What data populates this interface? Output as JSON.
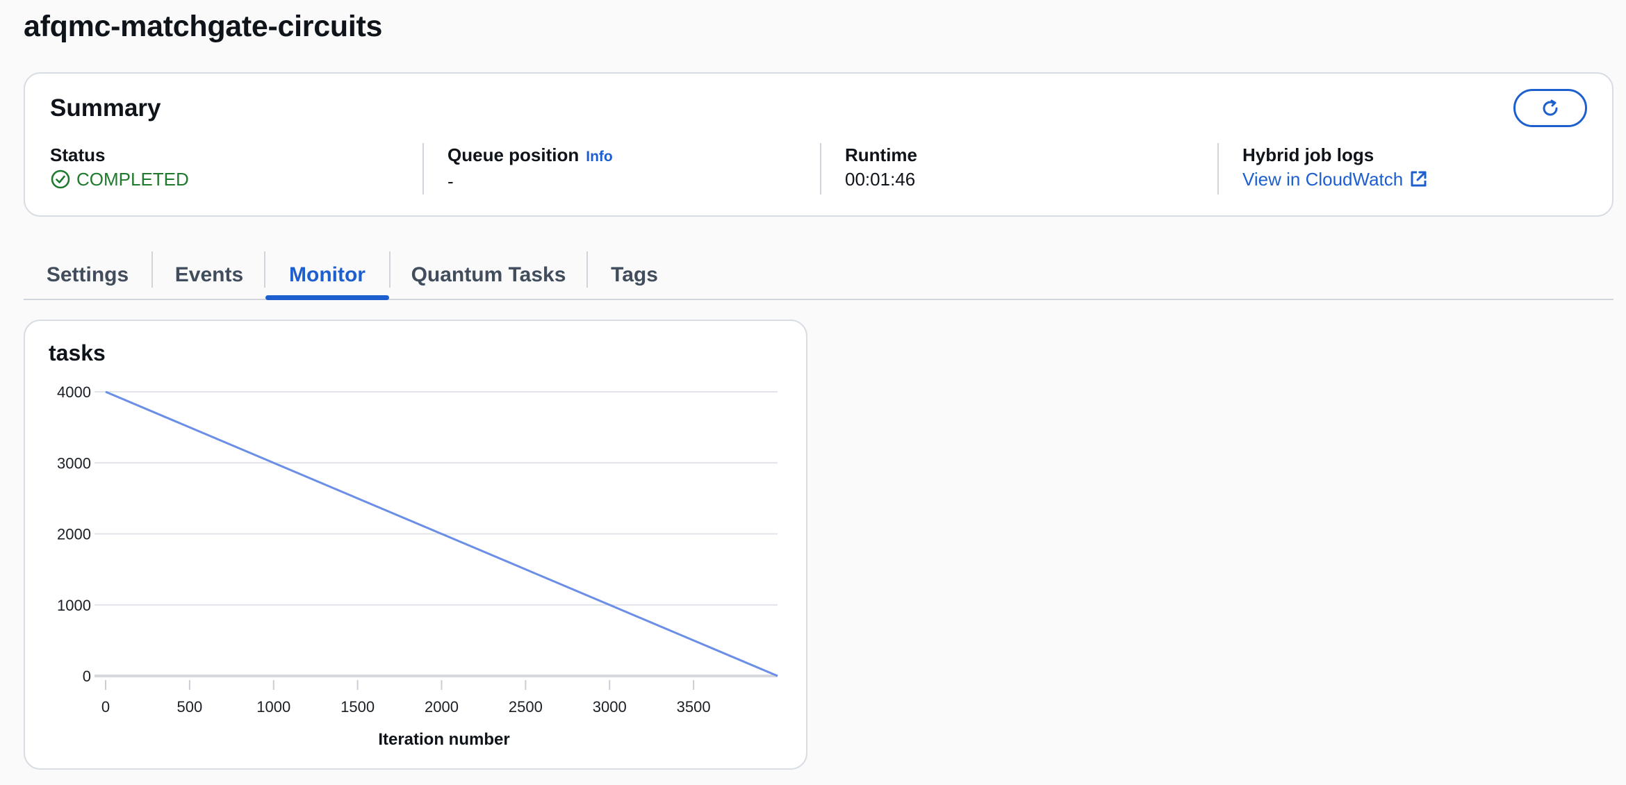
{
  "page": {
    "title": "afqmc-matchgate-circuits"
  },
  "summary": {
    "title": "Summary",
    "status_label": "Status",
    "status_value": "COMPLETED",
    "queue_label": "Queue position",
    "queue_info": "Info",
    "queue_value": "-",
    "runtime_label": "Runtime",
    "runtime_value": "00:01:46",
    "logs_label": "Hybrid job logs",
    "logs_link": "View in CloudWatch",
    "refresh_icon": "refresh-icon",
    "status_icon": "check-circle-icon",
    "external_icon": "external-link-icon"
  },
  "tabs": [
    {
      "label": "Settings",
      "active": false
    },
    {
      "label": "Events",
      "active": false
    },
    {
      "label": "Monitor",
      "active": true
    },
    {
      "label": "Quantum Tasks",
      "active": false
    },
    {
      "label": "Tags",
      "active": false
    }
  ],
  "colors": {
    "accent": "#1d5fce",
    "success": "#1f7a2e",
    "series": "#6b8ee6",
    "grid": "#e1e4e8"
  },
  "chart_data": {
    "type": "line",
    "title": "tasks",
    "xlabel": "Iteration number",
    "ylabel": "",
    "xlim": [
      0,
      4000
    ],
    "ylim": [
      0,
      4000
    ],
    "x_ticks": [
      0,
      500,
      1000,
      1500,
      2000,
      2500,
      3000,
      3500
    ],
    "y_ticks": [
      0,
      1000,
      2000,
      3000,
      4000
    ],
    "grid": true,
    "series": [
      {
        "x": [
          0,
          4000
        ],
        "y": [
          4000,
          0
        ]
      }
    ]
  }
}
